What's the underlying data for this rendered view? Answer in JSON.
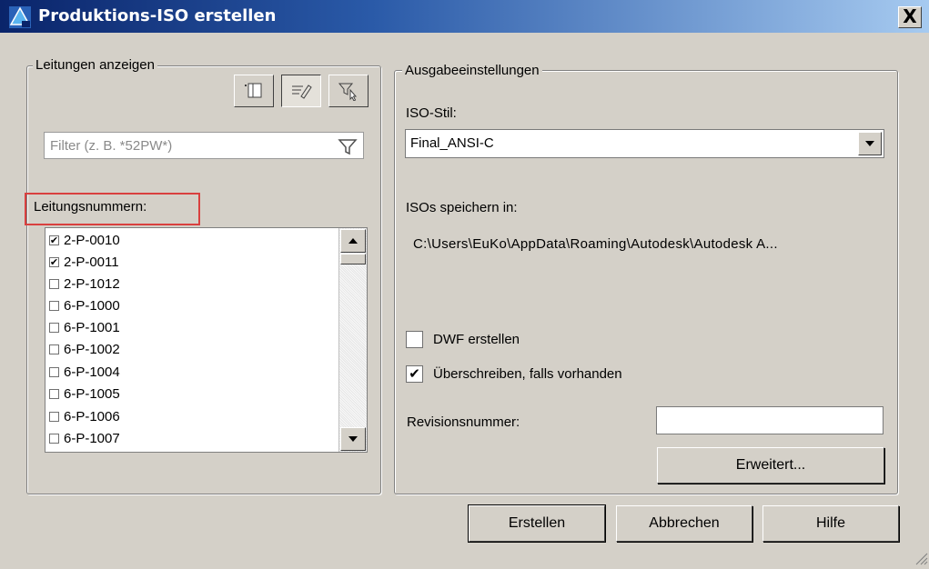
{
  "window": {
    "title": "Produktions-ISO erstellen",
    "close_label": "X"
  },
  "left_group": {
    "legend": "Leitungen anzeigen",
    "toolbar_icons": [
      "select-list-icon",
      "edit-list-icon",
      "select-filter-icon"
    ],
    "filter_placeholder": "Filter (z. B. *52PW*)",
    "list_label": "Leitungsnummern:",
    "lines": [
      {
        "label": "2-P-0010",
        "checked": true
      },
      {
        "label": "2-P-0011",
        "checked": true
      },
      {
        "label": "2-P-1012",
        "checked": false
      },
      {
        "label": "6-P-1000",
        "checked": false
      },
      {
        "label": "6-P-1001",
        "checked": false
      },
      {
        "label": "6-P-1002",
        "checked": false
      },
      {
        "label": "6-P-1004",
        "checked": false
      },
      {
        "label": "6-P-1005",
        "checked": false
      },
      {
        "label": "6-P-1006",
        "checked": false
      },
      {
        "label": "6-P-1007",
        "checked": false
      }
    ]
  },
  "right_group": {
    "legend": "Ausgabeeinstellungen",
    "iso_style_label": "ISO-Stil:",
    "iso_style_value": "Final_ANSI-C",
    "save_label": "ISOs speichern in:",
    "save_path": "C:\\Users\\EuKo\\AppData\\Roaming\\Autodesk\\Autodesk A...",
    "dwf_label": "DWF erstellen",
    "dwf_checked": false,
    "overwrite_label": "Überschreiben, falls vorhanden",
    "overwrite_checked": true,
    "revision_label": "Revisionsnummer:",
    "revision_value": "",
    "advanced_button": "Erweitert..."
  },
  "footer": {
    "create_button": "Erstellen",
    "cancel_button": "Abbrechen",
    "help_button": "Hilfe"
  },
  "colors": {
    "title_start": "#0a246a",
    "title_end": "#a6caf0",
    "face": "#d4d0c8",
    "highlight": "#d9403f"
  }
}
